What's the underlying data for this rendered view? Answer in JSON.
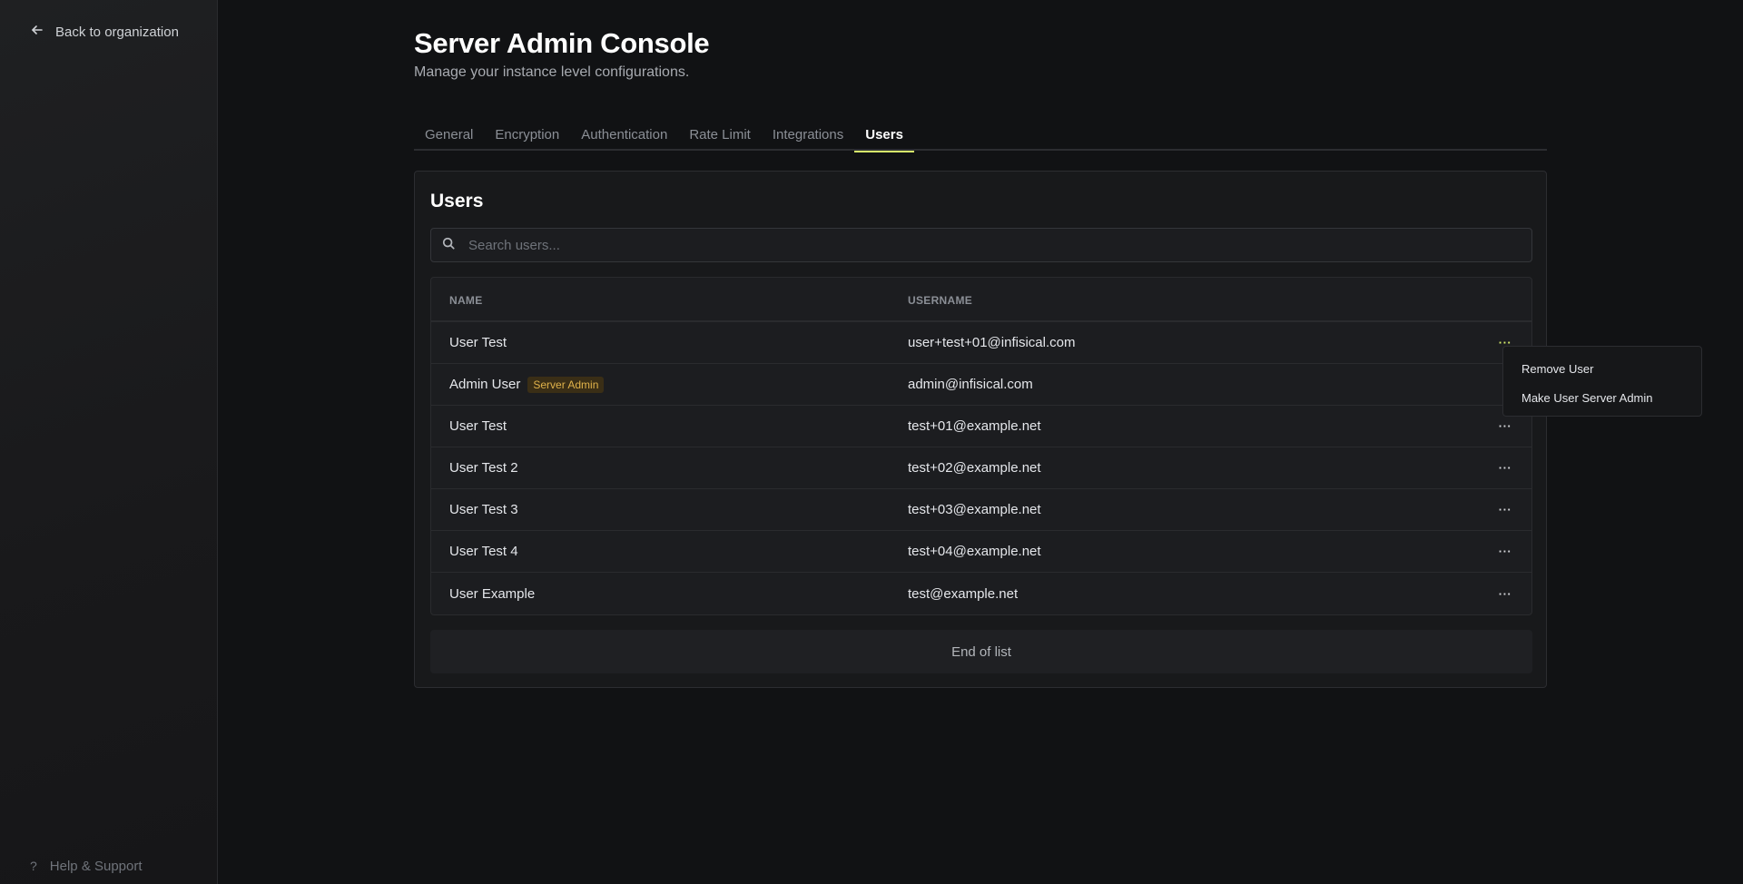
{
  "sidebar": {
    "back_label": "Back to organization",
    "help_label": "Help & Support",
    "help_icon": "?"
  },
  "header": {
    "title": "Server Admin Console",
    "subtitle": "Manage your instance level configurations."
  },
  "tabs": [
    {
      "label": "General"
    },
    {
      "label": "Encryption"
    },
    {
      "label": "Authentication"
    },
    {
      "label": "Rate Limit"
    },
    {
      "label": "Integrations"
    },
    {
      "label": "Users",
      "active": true
    }
  ],
  "users": {
    "title": "Users",
    "search_placeholder": "Search users...",
    "columns": {
      "name": "NAME",
      "username": "USERNAME"
    },
    "rows": [
      {
        "name": "User Test",
        "username": "user+test+01@infisical.com",
        "badge": ""
      },
      {
        "name": "Admin User",
        "username": "admin@infisical.com",
        "badge": "Server Admin"
      },
      {
        "name": "User Test",
        "username": "test+01@example.net",
        "badge": ""
      },
      {
        "name": "User Test 2",
        "username": "test+02@example.net",
        "badge": ""
      },
      {
        "name": "User Test 3",
        "username": "test+03@example.net",
        "badge": ""
      },
      {
        "name": "User Test 4",
        "username": "test+04@example.net",
        "badge": ""
      },
      {
        "name": "User Example",
        "username": "test@example.net",
        "badge": ""
      }
    ],
    "more_glyph": "···",
    "end_of_list": "End of list"
  },
  "dropdown": {
    "items": [
      {
        "label": "Remove User"
      },
      {
        "label": "Make User Server Admin"
      }
    ]
  },
  "colors": {
    "accent": "#d7ef6b",
    "badge_text": "#e0b24a",
    "badge_bg": "#3a2e16",
    "background": "#111214"
  }
}
